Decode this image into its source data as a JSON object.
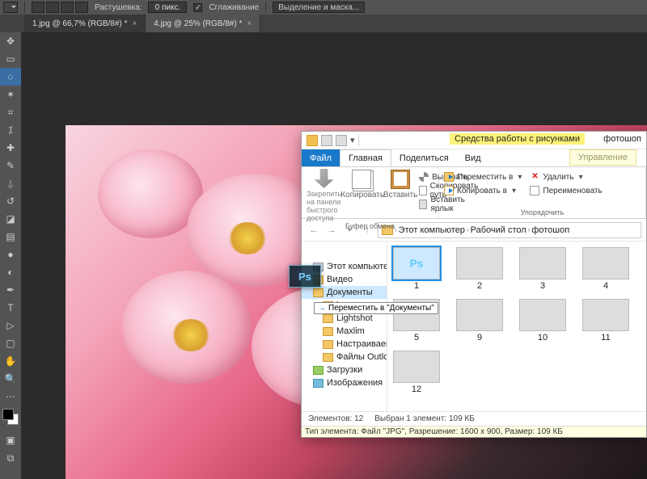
{
  "ps_options": {
    "feather_label": "Растушевка:",
    "feather_value": "0 пикс.",
    "antialias_label": "Сглаживание",
    "selectmask_btn": "Выделение и маска..."
  },
  "doc_tabs": [
    {
      "label": "1.jpg @ 66,7% (RGB/8#) *",
      "active": false
    },
    {
      "label": "4.jpg @ 25% (RGB/8#) *",
      "active": true
    }
  ],
  "explorer": {
    "context_tab": "Средства работы с рисунками",
    "window_title": "фотошоп",
    "tabs": {
      "file": "Файл",
      "home": "Главная",
      "share": "Поделиться",
      "view": "Вид",
      "manage": "Управление"
    },
    "ribbon": {
      "pin1": "Закрепить на панели",
      "pin2": "быстрого доступа",
      "copy": "Копировать",
      "paste": "Вставить",
      "cut": "Вырезать",
      "copypath": "Скопировать путь",
      "pasteshortcut": "Вставить ярлык",
      "clipboard_group": "Буфер обмена",
      "moveto": "Переместить в",
      "copyto": "Копировать в",
      "delete": "Удалить",
      "rename": "Переименовать",
      "organize_group": "Упорядочить"
    },
    "breadcrumb": {
      "c1": "Этот компьютер",
      "c2": "Рабочий стол",
      "c3": "фотошоп"
    },
    "nav": {
      "thispc": "Этот компьютер",
      "video": "Видео",
      "documents": "Документы",
      "insst": "insst",
      "lightshot": "Lightshot",
      "maxlim": "Maxlim",
      "customize": "Настраиваемые",
      "outlook": "Файлы Outlook",
      "downloads": "Загрузки",
      "images": "Изображения"
    },
    "thumbs": [
      "1",
      "2",
      "3",
      "4",
      "5",
      "9",
      "10",
      "11",
      "12"
    ],
    "status": {
      "count": "Элементов: 12",
      "selected": "Выбран 1 элемент: 109 КБ"
    },
    "tooltip": "Тип элемента: Файл \"JPG\", Разрешение: 1600 x 900, Размер: 109 КБ"
  },
  "drag": {
    "tooltip": "Переместить в \"Документы\""
  }
}
